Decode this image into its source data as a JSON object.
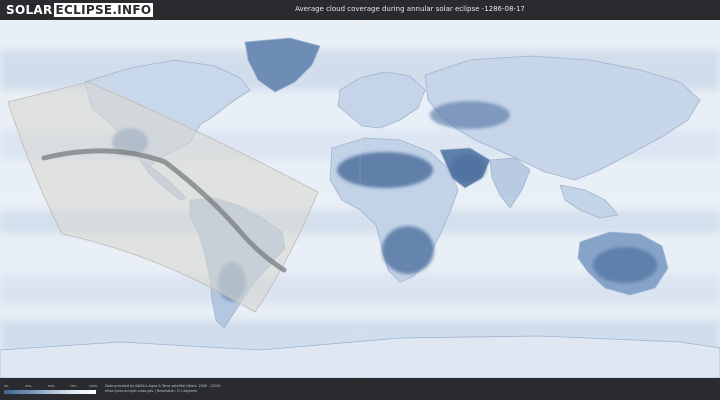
{
  "header": {
    "logo_part1": "SOLAR",
    "logo_part2": "ECLIPSE.INFO",
    "title": "Average cloud coverage during annular solar eclipse -1286-08-17"
  },
  "legend": {
    "scale_labels": [
      "0%",
      "25%",
      "50%",
      "75%",
      "100%"
    ],
    "scale_colors": [
      "#3f6593",
      "#6d8bb3",
      "#a9bdd7",
      "#dfe8f3",
      "#ffffff"
    ]
  },
  "footer": {
    "credit_line1": "Data provided by NASA's Aqua & Terra satellite (Years: 2000 - 2019)",
    "credit_line2": "https://neo.sci.gsfc.nasa.gov  |  Resolution: 0.1 degrees"
  },
  "map": {
    "ocean_color": "#e9eff6",
    "land_outline_color": "#9fb4cf",
    "clear_sky_color": "#4f72a0",
    "eclipse_zone_color": "#d9d7d0",
    "central_line_color": "#7a7c80"
  }
}
